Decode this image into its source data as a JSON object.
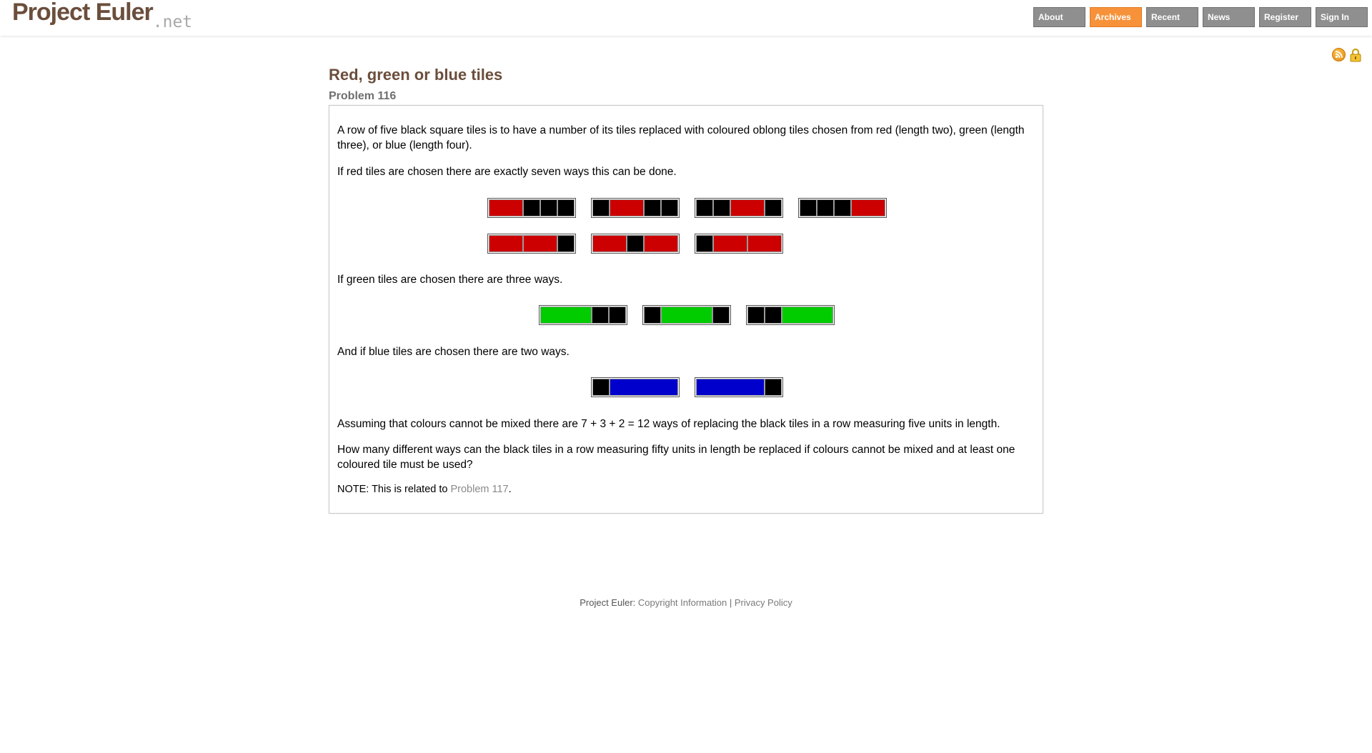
{
  "site": {
    "logo_main": "Project Euler",
    "logo_suffix": ".net"
  },
  "nav": [
    {
      "label": "About",
      "active": false
    },
    {
      "label": "Archives",
      "active": true
    },
    {
      "label": "Recent",
      "active": false
    },
    {
      "label": "News",
      "active": false
    },
    {
      "label": "Register",
      "active": false
    },
    {
      "label": "Sign In",
      "active": false
    }
  ],
  "colors": {
    "red": "#cc0000",
    "green": "#00cc00",
    "blue": "#0000cc",
    "black": "#000000",
    "accent": "#f7923a",
    "brand": "#6b4e3c"
  },
  "icons": [
    "rss-icon",
    "lock-icon"
  ],
  "problem": {
    "title": "Red, green or blue tiles",
    "number_label": "Problem 116",
    "para1": "A row of five black square tiles is to have a number of its tiles replaced with coloured oblong tiles chosen from red (length two), green (length three), or blue (length four).",
    "para2": "If red tiles are chosen there are exactly seven ways this can be done.",
    "para3": "If green tiles are chosen there are three ways.",
    "para4": "And if blue tiles are chosen there are two ways.",
    "para5": "Assuming that colours cannot be mixed there are 7 + 3 + 2 = 12 ways of replacing the black tiles in a row measuring five units in length.",
    "para6": "How many different ways can the black tiles in a row measuring fifty units in length be replaced if colours cannot be mixed and at least one coloured tile must be used?",
    "note_prefix": "NOTE: This is related to ",
    "note_link": "Problem 117",
    "note_suffix": "."
  },
  "tilings": {
    "red": [
      [
        [
          "R",
          2
        ],
        [
          "B",
          1
        ],
        [
          "B",
          1
        ],
        [
          "B",
          1
        ]
      ],
      [
        [
          "B",
          1
        ],
        [
          "R",
          2
        ],
        [
          "B",
          1
        ],
        [
          "B",
          1
        ]
      ],
      [
        [
          "B",
          1
        ],
        [
          "B",
          1
        ],
        [
          "R",
          2
        ],
        [
          "B",
          1
        ]
      ],
      [
        [
          "B",
          1
        ],
        [
          "B",
          1
        ],
        [
          "B",
          1
        ],
        [
          "R",
          2
        ]
      ],
      [
        [
          "R",
          2
        ],
        [
          "R",
          2
        ],
        [
          "B",
          1
        ]
      ],
      [
        [
          "R",
          2
        ],
        [
          "B",
          1
        ],
        [
          "R",
          2
        ]
      ],
      [
        [
          "B",
          1
        ],
        [
          "R",
          2
        ],
        [
          "R",
          2
        ]
      ]
    ],
    "green": [
      [
        [
          "G",
          3
        ],
        [
          "B",
          1
        ],
        [
          "B",
          1
        ]
      ],
      [
        [
          "B",
          1
        ],
        [
          "G",
          3
        ],
        [
          "B",
          1
        ]
      ],
      [
        [
          "B",
          1
        ],
        [
          "B",
          1
        ],
        [
          "G",
          3
        ]
      ]
    ],
    "blue": [
      [
        [
          "B",
          1
        ],
        [
          "U",
          4
        ]
      ],
      [
        [
          "U",
          4
        ],
        [
          "B",
          1
        ]
      ]
    ]
  },
  "footer": {
    "label": "Project Euler:",
    "copyright": "Copyright Information",
    "sep": "|",
    "privacy": "Privacy Policy"
  }
}
